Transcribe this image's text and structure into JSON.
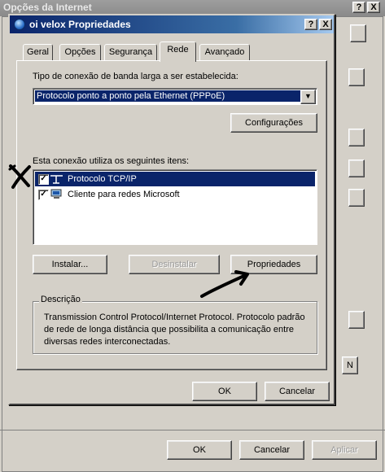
{
  "background_window": {
    "title": "Opções da Internet",
    "help_button": "?",
    "close_button": "X",
    "ok_label": "OK",
    "cancel_label": "Cancelar",
    "apply_label": "Aplicar",
    "partial_button_label": "N"
  },
  "dialog": {
    "title": "oi velox Propriedades",
    "help_button": "?",
    "close_button": "X",
    "tabs": [
      {
        "label": "Geral"
      },
      {
        "label": "Opções"
      },
      {
        "label": "Segurança"
      },
      {
        "label": "Rede",
        "active": true
      },
      {
        "label": "Avançado"
      }
    ],
    "connection_type_label": "Tipo de conexão de banda larga a ser estabelecida:",
    "connection_type_value": "Protocolo ponto a ponto pela Ethernet (PPPoE)",
    "configurations_button": "Configurações",
    "components_label": "Esta conexão utiliza os seguintes itens:",
    "components": [
      {
        "label": "Protocolo TCP/IP",
        "checked": true,
        "selected": true,
        "icon": "network-protocol-icon"
      },
      {
        "label": "Cliente para redes Microsoft",
        "checked": true,
        "selected": false,
        "icon": "network-client-icon"
      }
    ],
    "install_button": "Instalar...",
    "uninstall_button": "Desinstalar",
    "properties_button": "Propriedades",
    "description_legend": "Descrição",
    "description_text": "Transmission Control Protocol/Internet Protocol. Protocolo padrão de rede de longa distância que possibilita a comunicação entre diversas redes interconectadas.",
    "ok_label": "OK",
    "cancel_label": "Cancelar"
  },
  "annotations": {
    "x_mark": "hand-drawn-x-mark",
    "arrow": "hand-drawn-arrow"
  },
  "colors": {
    "window_bg": "#d4d0c8",
    "title_active": "#0a246a",
    "title_inactive": "#8a8a8a",
    "selection": "#0a246a"
  }
}
